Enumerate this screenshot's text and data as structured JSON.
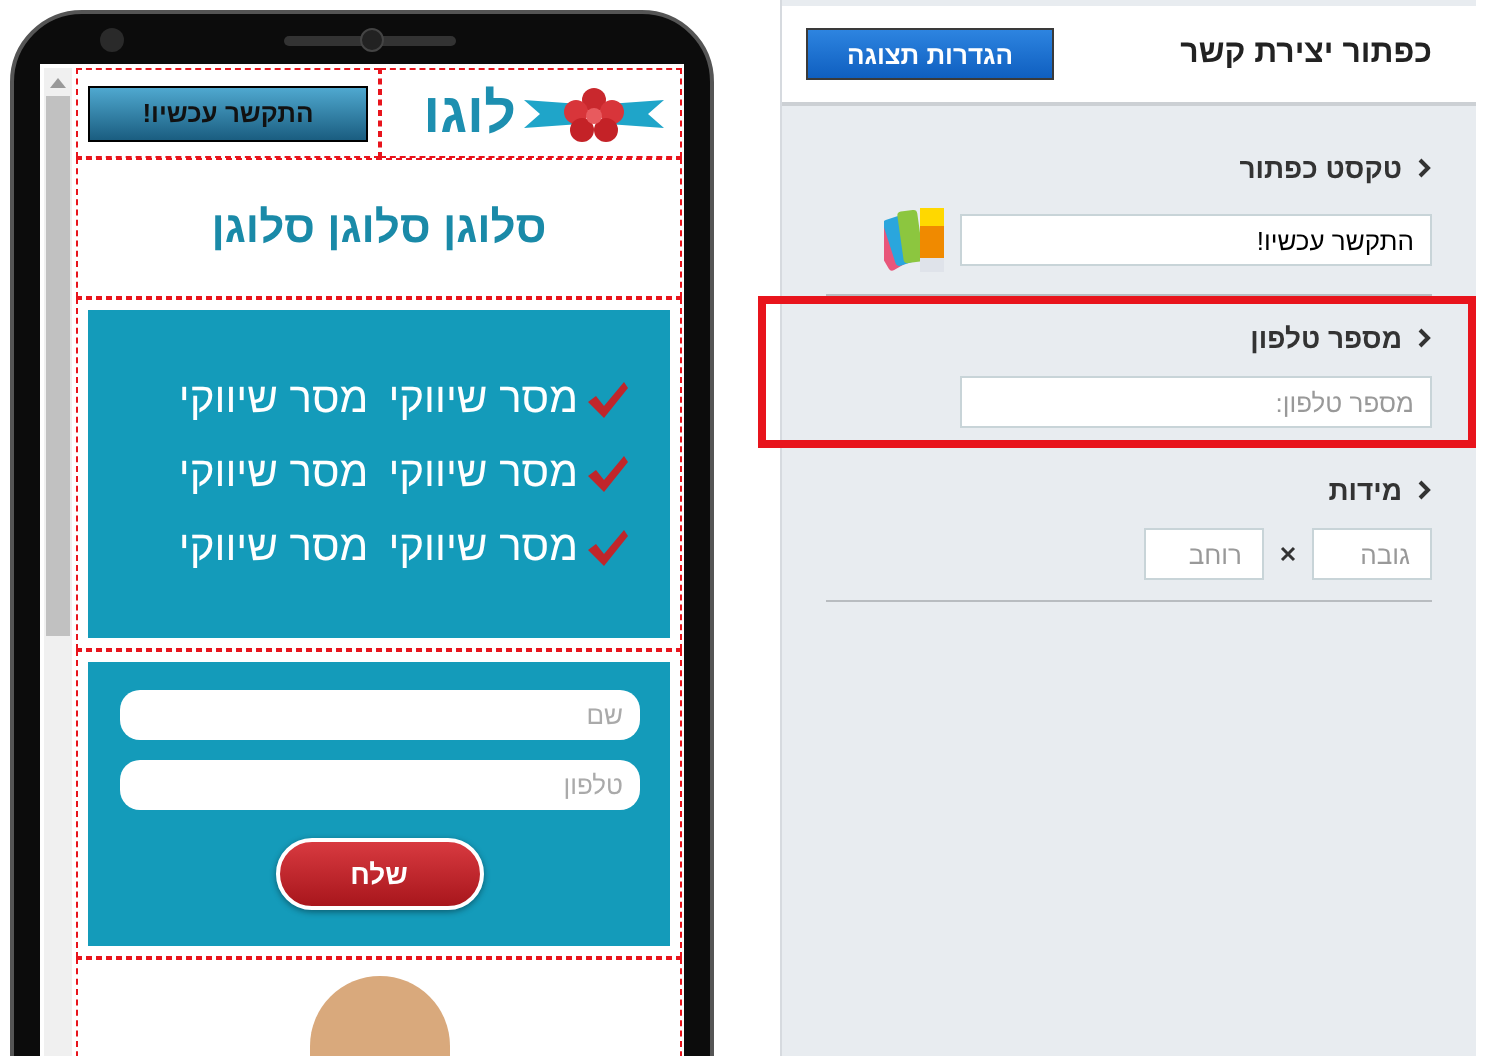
{
  "phone_preview": {
    "header": {
      "cta_button": "התקשר עכשיו!",
      "logo_text": "לוגו"
    },
    "slogan": "סלוגן סלוגן סלוגן",
    "messages": [
      {
        "parts": [
          "מסר שיווקי",
          "מסר שיווקי"
        ]
      },
      {
        "parts": [
          "מסר שיווקי",
          "מסר שיווקי"
        ]
      },
      {
        "parts": [
          "מסר שיווקי",
          "מסר שיווקי"
        ]
      }
    ],
    "form": {
      "fields": [
        {
          "placeholder": "שם"
        },
        {
          "placeholder": "טלפון"
        }
      ],
      "submit": "שלח"
    }
  },
  "panel": {
    "title": "כפתור יצירת קשר",
    "settings_button": "הגדרות תצוגה",
    "sections": [
      {
        "kind": "text",
        "label": "טקסט כפתור",
        "value": "התקשר עכשיו!",
        "highlighted": false
      },
      {
        "kind": "text",
        "label": "מספר טלפון",
        "placeholder": "מספר טלפון:",
        "highlighted": true
      },
      {
        "kind": "size",
        "label": "מידות",
        "height_placeholder": "גובה",
        "width_placeholder": "רוחב",
        "highlighted": false
      }
    ]
  }
}
